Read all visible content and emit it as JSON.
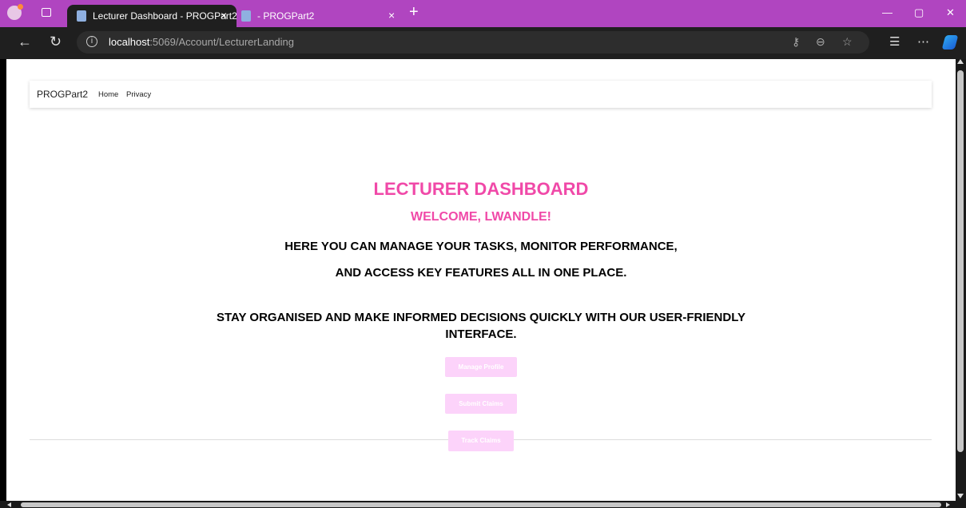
{
  "browser": {
    "tabs": [
      {
        "title": "Lecturer Dashboard - PROGPart2",
        "close": "×"
      },
      {
        "title": "- PROGPart2",
        "close": "×"
      }
    ],
    "new_tab": "+",
    "window_controls": {
      "minimize": "—",
      "restore": "▢",
      "close": "✕"
    },
    "url_host": "localhost",
    "url_path": ":5069/Account/LecturerLanding"
  },
  "navbar": {
    "brand": "PROGPart2",
    "links": [
      "Home",
      "Privacy"
    ]
  },
  "main": {
    "title": "LECTURER DASHBOARD",
    "welcome": "WELCOME, LWANDLE!",
    "line1": "HERE YOU CAN MANAGE YOUR TASKS, MONITOR PERFORMANCE,",
    "line2": "AND ACCESS KEY FEATURES ALL IN ONE PLACE.",
    "line3": "STAY ORGANISED AND MAKE INFORMED DECISIONS QUICKLY WITH OUR USER-FRIENDLY",
    "line4": "INTERFACE.",
    "buttons": [
      "Manage Profile",
      "Submit Claims",
      "Track Claims"
    ]
  },
  "colors": {
    "accent": "#f049a8",
    "button_bg": "#fcd3fa",
    "titlebar": "#b045c0"
  }
}
